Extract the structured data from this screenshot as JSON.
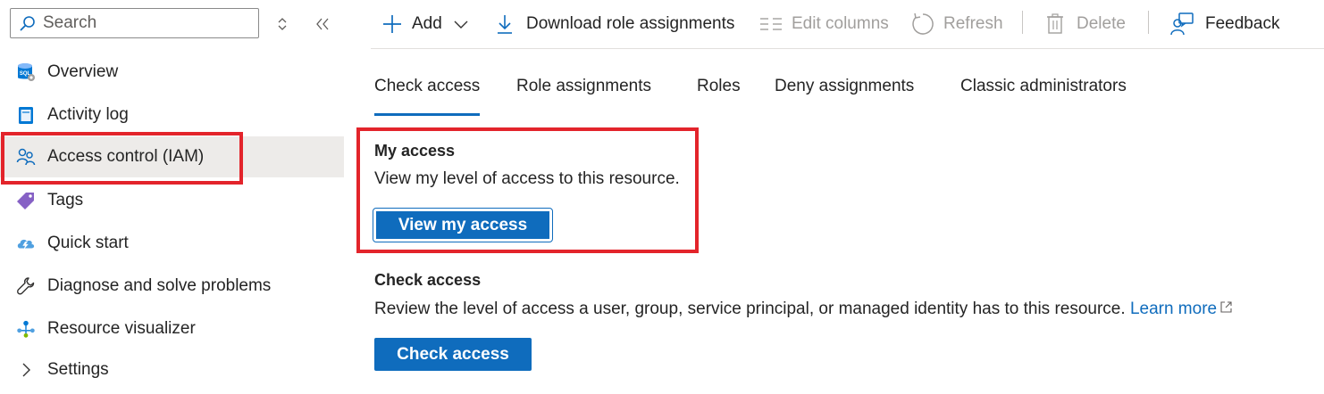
{
  "sidebar": {
    "search": {
      "placeholder": "Search"
    },
    "items": [
      {
        "label": "Overview",
        "icon": "sql-database-icon"
      },
      {
        "label": "Activity log",
        "icon": "activity-log-icon"
      },
      {
        "label": "Access control (IAM)",
        "icon": "people-icon",
        "selected": true
      },
      {
        "label": "Tags",
        "icon": "tag-icon"
      },
      {
        "label": "Quick start",
        "icon": "cloud-icon"
      },
      {
        "label": "Diagnose and solve problems",
        "icon": "wrench-icon"
      },
      {
        "label": "Resource visualizer",
        "icon": "hierarchy-icon"
      },
      {
        "label": "Settings",
        "icon": "chevron-right-icon"
      }
    ]
  },
  "toolbar": {
    "add": "Add",
    "download": "Download role assignments",
    "edit_columns": "Edit columns",
    "refresh": "Refresh",
    "delete": "Delete",
    "feedback": "Feedback"
  },
  "tabs": [
    {
      "label": "Check access",
      "active": true
    },
    {
      "label": "Role assignments"
    },
    {
      "label": "Roles"
    },
    {
      "label": "Deny assignments"
    },
    {
      "label": "Classic administrators"
    }
  ],
  "my_access": {
    "title": "My access",
    "description": "View my level of access to this resource.",
    "button": "View my access"
  },
  "check_access": {
    "title": "Check access",
    "description": "Review the level of access a user, group, service principal, or managed identity has to this resource.",
    "learn_more": "Learn more",
    "button": "Check access"
  },
  "colors": {
    "accent": "#0f6cbd",
    "highlight": "#e3242b",
    "selected_bg": "#edebe9",
    "disabled": "#a19f9d"
  }
}
